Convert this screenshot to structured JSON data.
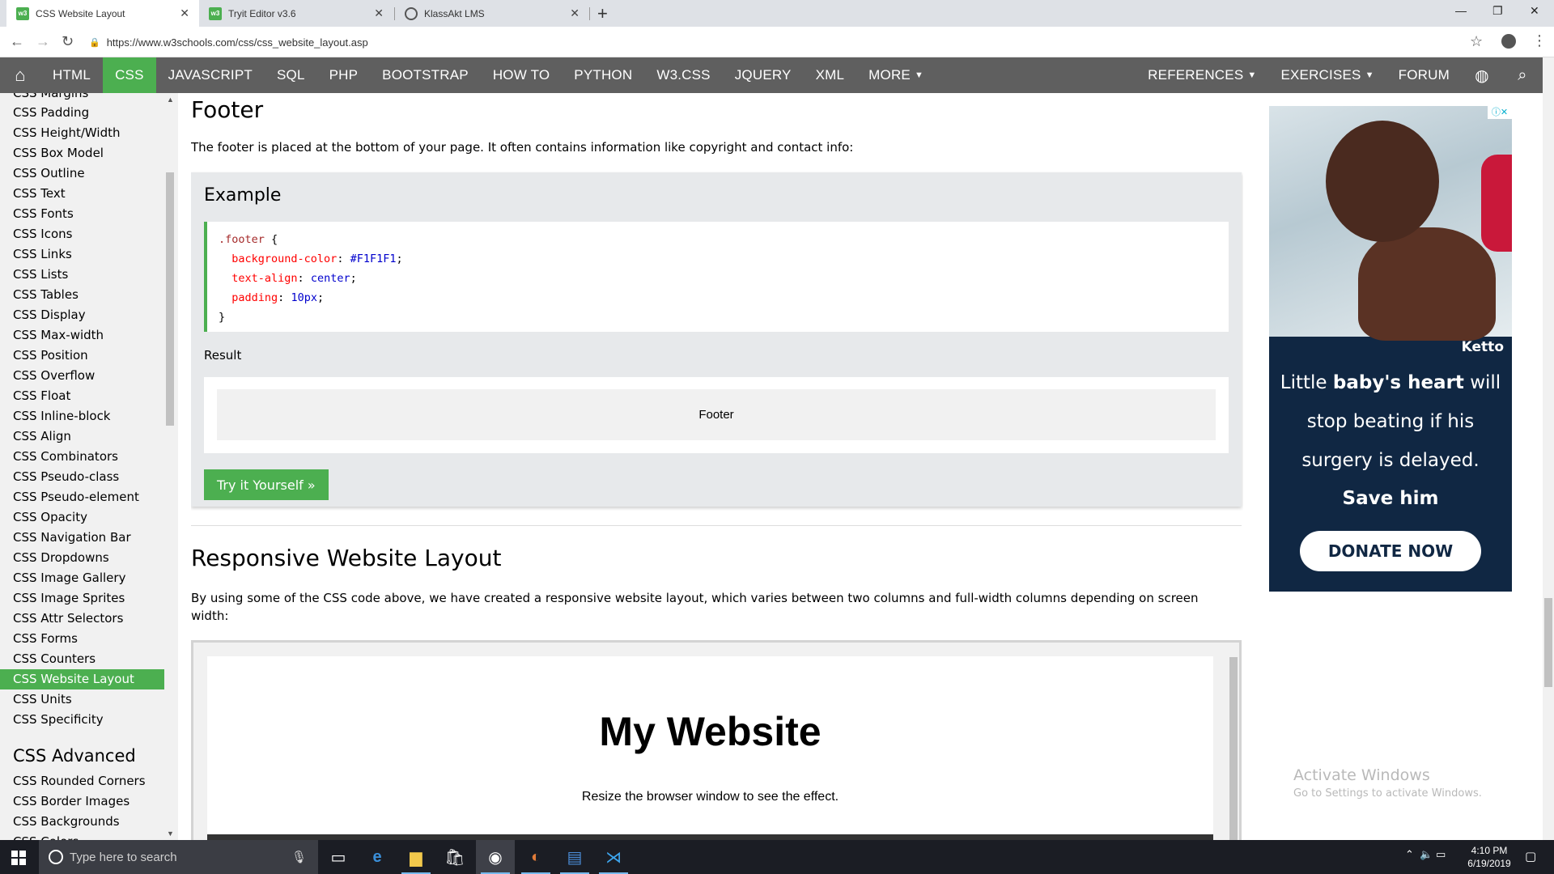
{
  "browser": {
    "tabs": [
      {
        "title": "CSS Website Layout",
        "favicon": "w3-icon",
        "active": true
      },
      {
        "title": "Tryit Editor v3.6",
        "favicon": "w3-icon",
        "active": false
      },
      {
        "title": "KlassAkt LMS",
        "favicon": "globe-icon",
        "active": false
      }
    ],
    "url": "https://www.w3schools.com/css/css_website_layout.asp"
  },
  "topnav": {
    "items": [
      "HTML",
      "CSS",
      "JAVASCRIPT",
      "SQL",
      "PHP",
      "BOOTSTRAP",
      "HOW TO",
      "PYTHON",
      "W3.CSS",
      "JQUERY",
      "XML",
      "MORE"
    ],
    "active": "CSS",
    "right_items": [
      "REFERENCES",
      "EXERCISES",
      "FORUM"
    ]
  },
  "sidebar": {
    "items": [
      "CSS Margins",
      "CSS Padding",
      "CSS Height/Width",
      "CSS Box Model",
      "CSS Outline",
      "CSS Text",
      "CSS Fonts",
      "CSS Icons",
      "CSS Links",
      "CSS Lists",
      "CSS Tables",
      "CSS Display",
      "CSS Max-width",
      "CSS Position",
      "CSS Overflow",
      "CSS Float",
      "CSS Inline-block",
      "CSS Align",
      "CSS Combinators",
      "CSS Pseudo-class",
      "CSS Pseudo-element",
      "CSS Opacity",
      "CSS Navigation Bar",
      "CSS Dropdowns",
      "CSS Image Gallery",
      "CSS Image Sprites",
      "CSS Attr Selectors",
      "CSS Forms",
      "CSS Counters",
      "CSS Website Layout",
      "CSS Units",
      "CSS Specificity"
    ],
    "active": "CSS Website Layout",
    "advanced_heading": "CSS Advanced",
    "advanced_items": [
      "CSS Rounded Corners",
      "CSS Border Images",
      "CSS Backgrounds",
      "CSS Colors"
    ]
  },
  "main": {
    "footer_heading": "Footer",
    "footer_desc": "The footer is placed at the bottom of your page. It often contains information like copyright and contact info:",
    "example_title": "Example",
    "code": {
      "selector": ".footer",
      "open": " {",
      "props": [
        {
          "name": "background-color",
          "value": "#F1F1F1"
        },
        {
          "name": "text-align",
          "value": "center"
        },
        {
          "name": "padding",
          "value": "10px"
        }
      ],
      "close": "}"
    },
    "result_label": "Result",
    "result_footer": "Footer",
    "tryit_label": "Try it Yourself »",
    "responsive_heading": "Responsive Website Layout",
    "responsive_desc": "By using some of the CSS code above, we have created a responsive website layout, which varies between two columns and full-width columns depending on screen width:",
    "demo_title": "My Website",
    "demo_subtitle": "Resize the browser window to see the effect."
  },
  "ad": {
    "logo": "Ketto",
    "line1_pre": "Little ",
    "line1_bold": "baby's heart",
    "line1_post": " will",
    "line2": "stop beating if his",
    "line3": "surgery is delayed.",
    "line4": "Save him",
    "cta": "DONATE NOW",
    "bg_color": "#102743"
  },
  "watermark": {
    "title": "Activate Windows",
    "subtitle": "Go to Settings to activate Windows."
  },
  "taskbar": {
    "search_placeholder": "Type here to search",
    "time": "4:10 PM",
    "date": "6/19/2019"
  },
  "colors": {
    "accent": "#4caf50",
    "nav_bg": "#5f5f5f"
  }
}
